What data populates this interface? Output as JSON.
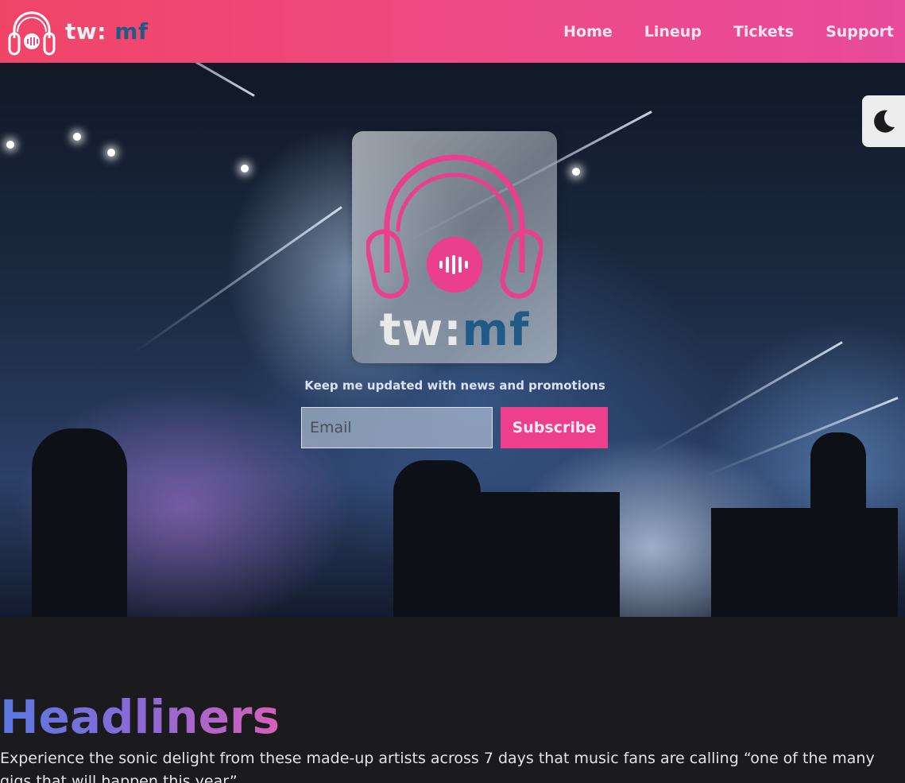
{
  "brand": {
    "name_part1": "tw:",
    "name_part2": "mf",
    "logo_icon": "headphones-icon"
  },
  "nav": {
    "items": [
      {
        "label": "Home"
      },
      {
        "label": "Lineup"
      },
      {
        "label": "Tickets"
      },
      {
        "label": "Support"
      }
    ]
  },
  "theme_toggle": {
    "icon": "moon-icon"
  },
  "hero": {
    "logo_text_part1": "tw:",
    "logo_text_part2": "mf",
    "newsletter_label": "Keep me updated with news and promotions",
    "email_placeholder": "Email",
    "email_value": "",
    "subscribe_label": "Subscribe"
  },
  "headliners": {
    "title": "Headliners",
    "description": "Experience the sonic delight from these made-up artists across 7 days that music fans are calling “one of the many gigs that will happen this year”"
  },
  "colors": {
    "nav_start": "#f04467",
    "nav_end": "#e84a9c",
    "accent_pink": "#ee3f8c",
    "brand_blue": "#1f5b86",
    "page_bg": "#1b1b1d"
  }
}
